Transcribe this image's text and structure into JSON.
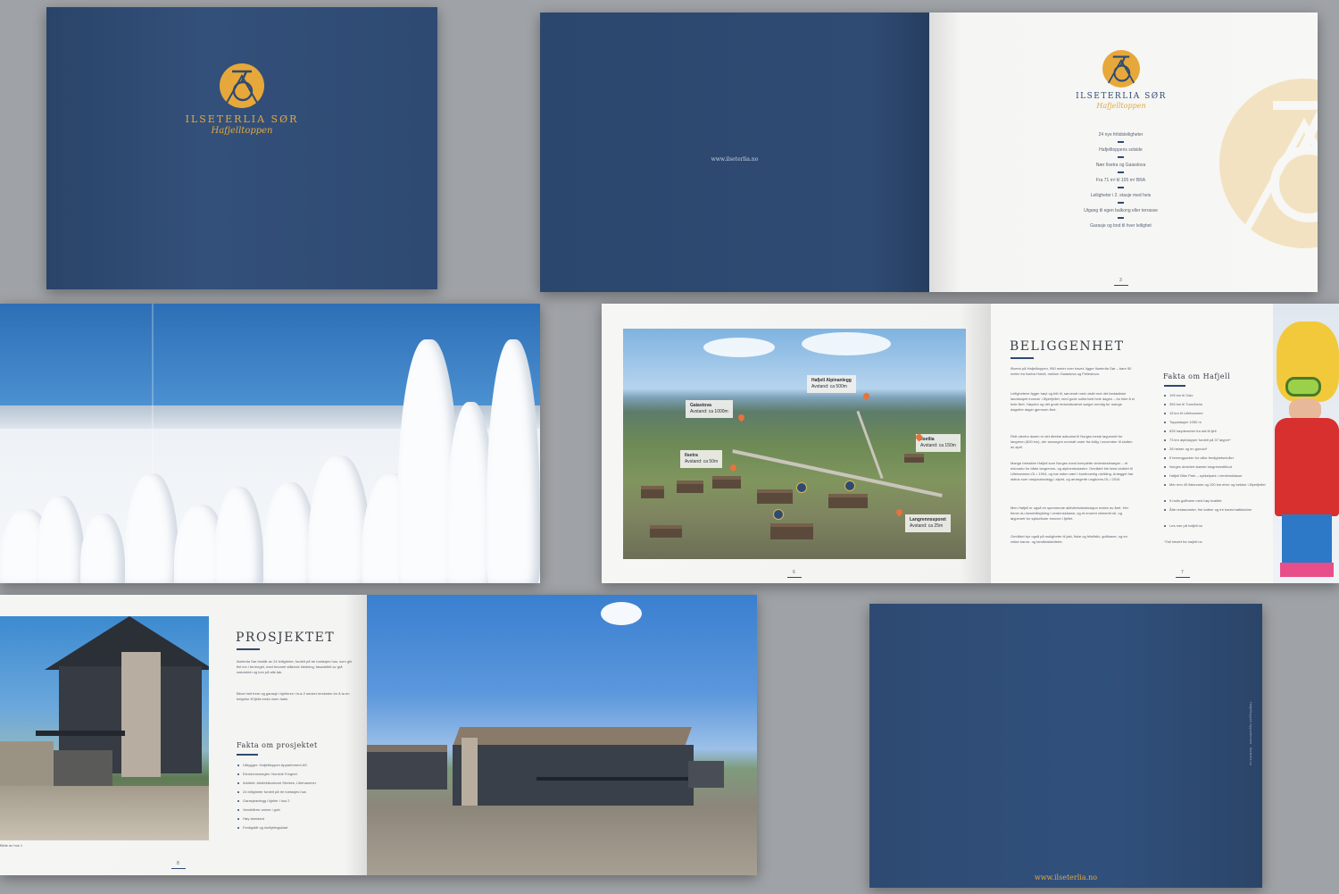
{
  "cover": {
    "brand_name": "ILSETERLIA SØR",
    "brand_sub": "Hafjelltoppen"
  },
  "intro": {
    "url": "www.ilseterlia.no",
    "brand_name": "ILSETERLIA SØR",
    "brand_sub": "Hafjelltoppen",
    "features": [
      "24 nye fritidsleiligheter",
      "Hafjelltoppens solside",
      "Nær Ilsetra og Gaiastova",
      "Fra 71 m² til 105 m² BRA",
      "Leiligheter i 2. etasje med heis",
      "Utgang til egen balkong eller terrasse",
      "Garasje og bod til hver leilighet"
    ],
    "page_number": "3"
  },
  "location": {
    "map_labels": [
      {
        "name": "Gaiastova",
        "distance": "Avstand: ca 1000m"
      },
      {
        "name": "Hafjell Alpinanlegg",
        "distance": "Avstand: ca 500m"
      },
      {
        "name": "Ilsetra",
        "distance": "Avstand: ca 50m"
      },
      {
        "name": "Ilsetlia",
        "distance": "Avstand: ca 150m"
      },
      {
        "name": "Langrennssporet",
        "distance": "Avstand: ca 25m"
      }
    ],
    "heading": "BELIGGENHET",
    "paragraphs": [
      "Øverst på Hafjelltoppen, 950 meter over havet, ligger Ilseterlia Sør – bare 50 meter fra Ilsetra Hotell, mellom Gaiastova og Pellestova.",
      "Leilighetene ligger høyt og fritt til, sørvendt med utsikt mot det fantastiske landskapet innover i Øyerfjellet, med gode solforhold hele dagen – for ikke å si hele året. Høyden og det gode innlandsværet sørger nemlig for mange døgnfrie dager gjennom året.",
      "Rett utenfor døren er det direkte adkomst til Norges beste løypenett for langrenn (600 km), der sesongen normalt varer fra tidlig i november til slutten av april.",
      "Mange betrakter Hafjell som Norges mest komplette vinterdestinasjon – et eldorado for både langrenns- og alpinentusiaster. Området ble først utviklet til Lillehammer-OL i 1994, og har siden vært i kontinuerlig utvikling. Anlegget har status som nasjonalanlegg i alpint, og arrangerte ungdoms-OL i 2016.",
      "Men Hafjell er også en spennende aktivitetsdestinasjon resten av året. Her finner du downhillsykling i verdensklasse, og et enormt velmerkt sti- og løypenett for sykkelturer innover i fjellet.",
      "Området byr også på muligheter til jakt, fiske og friluftsliv, golfbaner, og en rekke barne- og familieaktiviteter."
    ],
    "facts_heading": "Fakta om Hafjell",
    "facts": [
      "195 km til Oslo",
      "355 km til Trondheim",
      "15 km til Lillehammer",
      "Toppstasjon 1050 m",
      "835 høydemeter fra dal til fjell",
      "73 km alpinløyper fordelt på 37 løyper*",
      "28 heiser og en gondol*",
      "5 terrengparker for ulike ferdighetsnivåer",
      "Norges desidert største langrennstilbud",
      "Hafjell Bike Park – sykkelpark i verdensklasse",
      "Mer enn 40 fiskevann og 100 km elver og bekker i Øyerfjellet",
      "9-hulls golfbane med høy kvalitet",
      "Åtte restauranter, fire kafeer og tre barer/nattklubber",
      "Les mer på hafjell.no"
    ],
    "footnote": "*Tall hentet fra hafjell.no",
    "page_left": "6",
    "page_right": "7"
  },
  "project": {
    "heading": "PROSJEKTET",
    "paragraphs": [
      "Ilseterlia Sør består av 24 leiligheter, fordelt på tre toetasjes hus, som glir fint inn i terrenget, med bevaret stående kledning, fasadefelt av grå naturstein og torv på alle tak.",
      "Bilvei helt frem og garasje i kjelleren i hus 2 senker terskelen for å ta en helgetur til fjells enda noen hakk."
    ],
    "facts_heading": "Fakta om prosjektet",
    "facts": [
      "Utbygger: Hafjelltoppen Appartement AS",
      "Eiendomsmegler: Nordvik Fregnet",
      "Arkitekt: Arkitektkontoret Streken, Lillehammer",
      "24 leiligheter fordelt på tre toetasjes hus",
      "Garasjeanlegg i kjeller i hus 2",
      "Vannbåren varme i gulv",
      "Høy standard",
      "Ferdigstilt og innflyttingsklart"
    ],
    "caption": "Bilde av hus 1",
    "page_number": "8"
  },
  "back_cover": {
    "url": "www.ilseterlia.no",
    "spine": "Hafjelltoppen Appartement · ilseterlia.no"
  }
}
